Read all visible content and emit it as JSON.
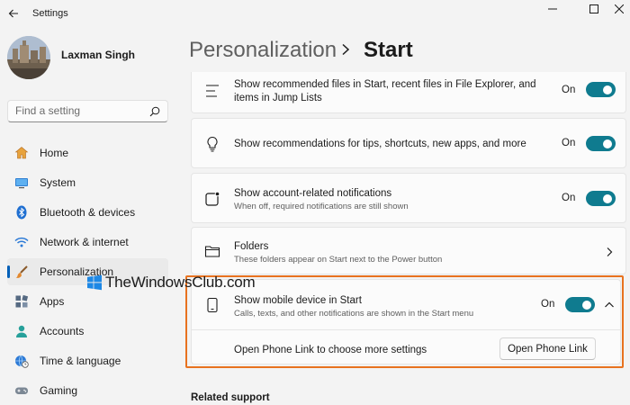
{
  "window": {
    "title": "Settings",
    "back_icon": "back-arrow-icon",
    "controls": [
      "minimize-icon",
      "maximize-icon",
      "close-icon"
    ]
  },
  "profile": {
    "name": "Laxman Singh"
  },
  "search": {
    "placeholder": "Find a setting",
    "icon": "search-icon"
  },
  "nav": {
    "items": [
      {
        "label": "Home",
        "icon": "home-icon",
        "active": false
      },
      {
        "label": "System",
        "icon": "system-icon",
        "active": false
      },
      {
        "label": "Bluetooth & devices",
        "icon": "bluetooth-icon",
        "active": false
      },
      {
        "label": "Network & internet",
        "icon": "wifi-icon",
        "active": false
      },
      {
        "label": "Personalization",
        "icon": "brush-icon",
        "active": true
      },
      {
        "label": "Apps",
        "icon": "apps-icon",
        "active": false
      },
      {
        "label": "Accounts",
        "icon": "person-icon",
        "active": false
      },
      {
        "label": "Time & language",
        "icon": "globe-clock-icon",
        "active": false
      },
      {
        "label": "Gaming",
        "icon": "gamepad-icon",
        "active": false
      }
    ]
  },
  "header": {
    "parent": "Personalization",
    "current": "Start"
  },
  "settings": {
    "recommended_files": {
      "title": "Show recommended files in Start, recent files in File Explorer, and items in Jump Lists",
      "state": "On",
      "icon": "list-icon"
    },
    "recommendations": {
      "title": "Show recommendations for tips, shortcuts, new apps, and more",
      "state": "On",
      "icon": "lightbulb-icon"
    },
    "account_notifications": {
      "title": "Show account-related notifications",
      "desc": "When off, required notifications are still shown",
      "state": "On",
      "icon": "notification-square-icon"
    },
    "folders": {
      "title": "Folders",
      "desc": "These folders appear on Start next to the Power button",
      "icon": "folder-icon"
    },
    "mobile_device": {
      "title": "Show mobile device in Start",
      "desc": "Calls, texts, and other notifications are shown in the Start menu",
      "state": "On",
      "icon": "phone-icon",
      "sub_label": "Open Phone Link to choose more settings",
      "button": "Open Phone Link"
    }
  },
  "watermark": {
    "text": "TheWindowsClub.com"
  },
  "related": {
    "heading": "Related support"
  },
  "colors": {
    "accent": "#0f7b8f",
    "nav_indicator": "#005fb8",
    "highlight": "#e8721f"
  }
}
